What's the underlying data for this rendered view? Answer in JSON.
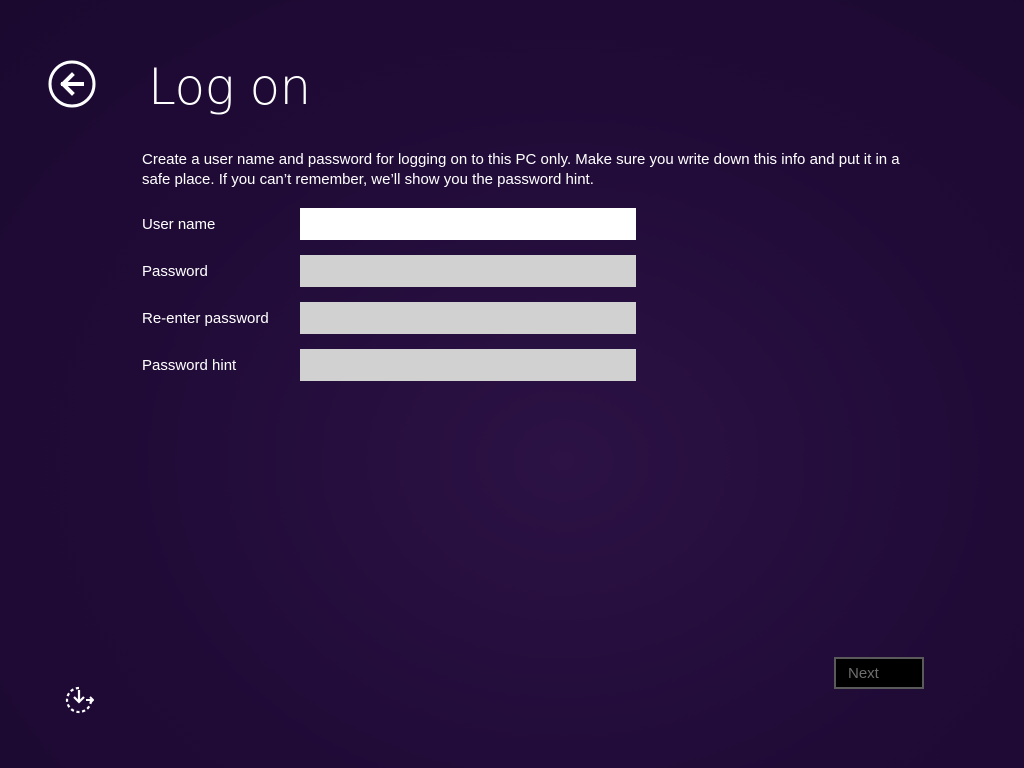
{
  "header": {
    "title": "Log on",
    "back_icon": "back-arrow-circle-icon"
  },
  "main": {
    "description": "Create a user name and password for logging on to this PC only. Make sure you write down this info and put it in a safe place. If you can’t remember, we’ll show you the password hint.",
    "fields": [
      {
        "label": "User name",
        "value": "",
        "placeholder": ""
      },
      {
        "label": "Password",
        "value": "",
        "placeholder": ""
      },
      {
        "label": "Re-enter password",
        "value": "",
        "placeholder": ""
      },
      {
        "label": "Password hint",
        "value": "",
        "placeholder": ""
      }
    ]
  },
  "footer": {
    "next_label": "Next",
    "ease_of_access_icon": "ease-of-access-icon"
  },
  "colors": {
    "background": "#200b37",
    "text": "#ffffff",
    "input_active": "#ffffff",
    "input_inactive": "#d1d1d1",
    "button_disabled_text": "#6e6e6e"
  }
}
